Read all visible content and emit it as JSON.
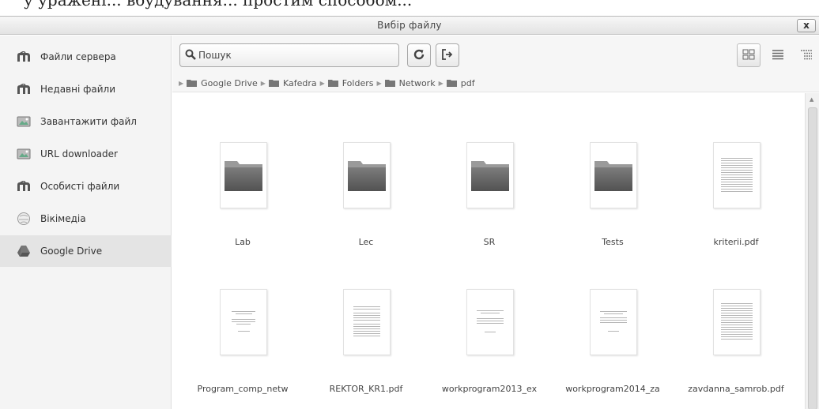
{
  "background_text": "у уражені... вбудування... простим способом...",
  "dialog": {
    "title": "Вибір файлу",
    "close_label": "x"
  },
  "sidebar": {
    "items": [
      {
        "label": "Файли сервера",
        "icon": "moodle-icon"
      },
      {
        "label": "Недавні файли",
        "icon": "moodle-icon"
      },
      {
        "label": "Завантажити файл",
        "icon": "upload-icon"
      },
      {
        "label": "URL downloader",
        "icon": "download-icon"
      },
      {
        "label": "Особисті файли",
        "icon": "moodle-icon"
      },
      {
        "label": "Вікімедіа",
        "icon": "wikimedia-icon"
      },
      {
        "label": "Google Drive",
        "icon": "google-drive-icon",
        "active": true
      }
    ]
  },
  "toolbar": {
    "search_placeholder": "Пошук",
    "refresh_icon": "refresh-icon",
    "logout_icon": "logout-icon",
    "views": [
      "icons-view",
      "list-view",
      "tree-view"
    ],
    "active_view": "icons-view"
  },
  "breadcrumb": [
    "Google Drive",
    "Kafedra",
    "Folders",
    "Network",
    "pdf"
  ],
  "files": [
    {
      "name": "Lab",
      "type": "folder"
    },
    {
      "name": "Lec",
      "type": "folder"
    },
    {
      "name": "SR",
      "type": "folder"
    },
    {
      "name": "Tests",
      "type": "folder"
    },
    {
      "name": "kriterii.pdf",
      "type": "pdf"
    },
    {
      "name": "Program_comp_netw",
      "type": "pdf"
    },
    {
      "name": "REKTOR_KR1.pdf",
      "type": "pdf"
    },
    {
      "name": "workprogram2013_ex",
      "type": "pdf"
    },
    {
      "name": "workprogram2014_za",
      "type": "pdf"
    },
    {
      "name": "zavdanna_samrob.pdf",
      "type": "pdf"
    }
  ],
  "colors": {
    "active_sidebar": "#e4e4e4",
    "folder_dark": "#666666"
  }
}
